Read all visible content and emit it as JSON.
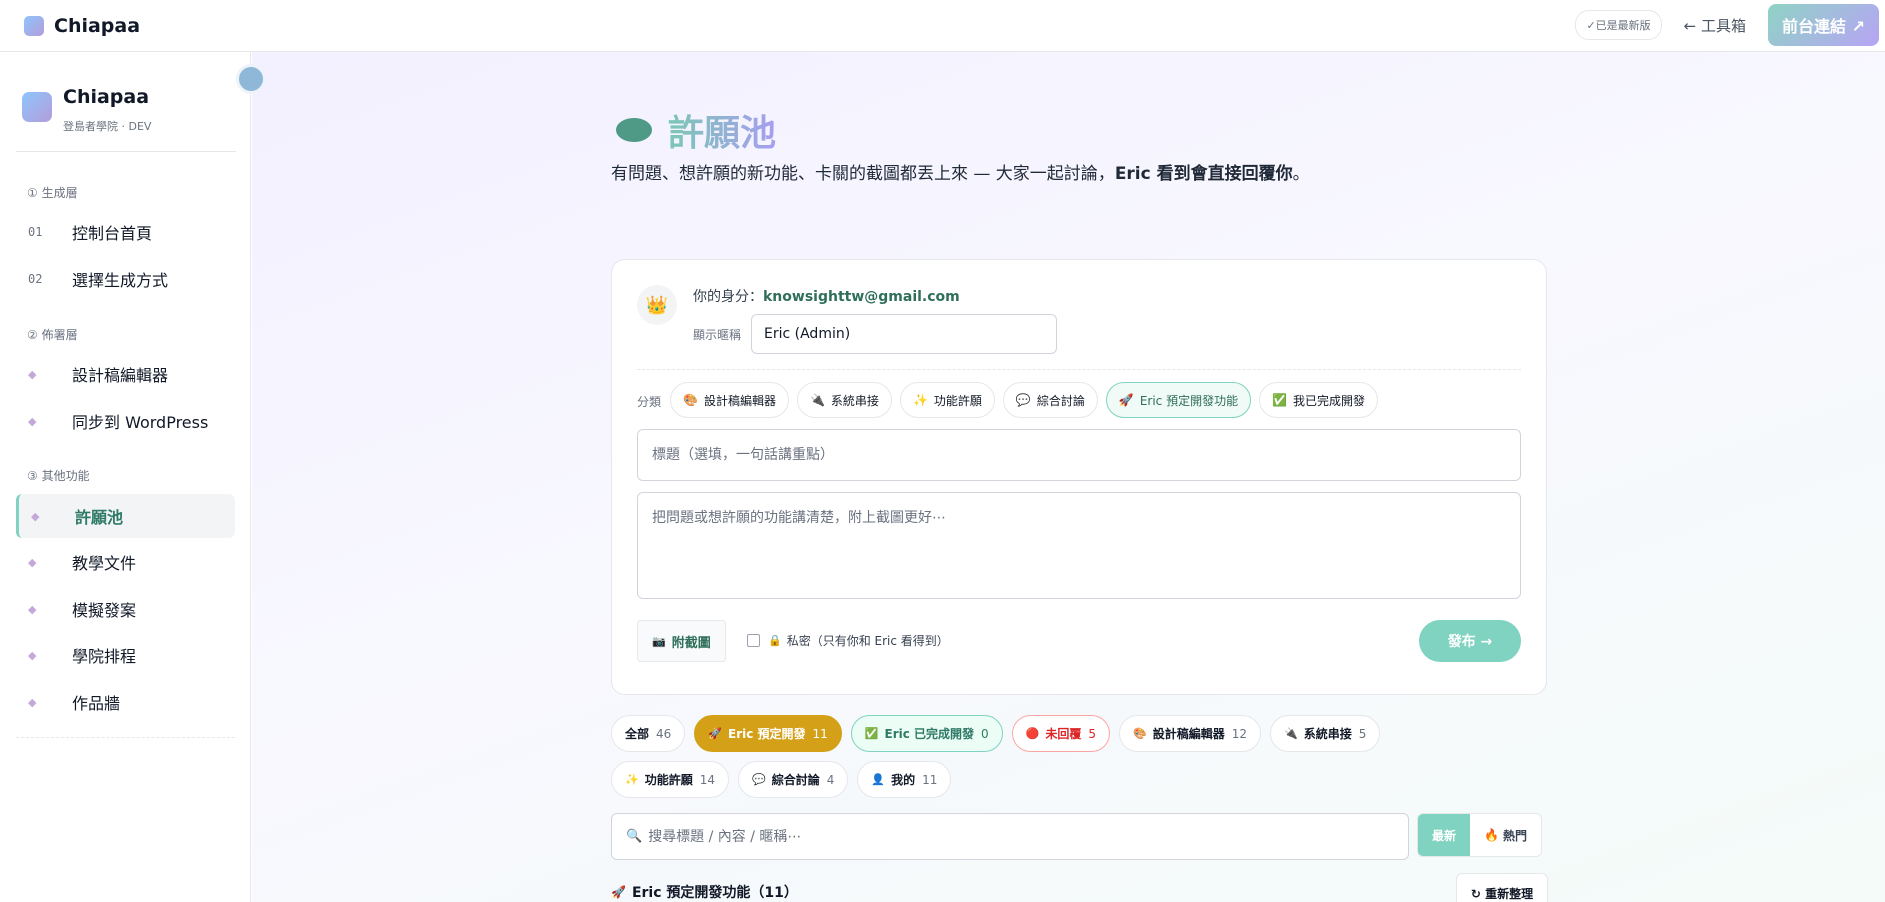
{
  "header": {
    "brand": "Chiapaa",
    "latest_badge": "✓已是最新版",
    "toolbox_link": "← 工具箱",
    "frontend_button": "前台連結 ↗"
  },
  "sidebar": {
    "title": "Chiapaa",
    "subtitle": "登島者學院 · DEV",
    "sections": [
      {
        "label": "① 生成層"
      },
      {
        "label": "② 佈署層"
      },
      {
        "label": "③ 其他功能"
      }
    ],
    "items": [
      {
        "marker": "01",
        "label": "控制台首頁"
      },
      {
        "marker": "02",
        "label": "選擇生成方式"
      },
      {
        "marker": "◆",
        "label": "設計稿編輯器"
      },
      {
        "marker": "◆",
        "label": "同步到 WordPress"
      },
      {
        "marker": "◆",
        "label": "許願池"
      },
      {
        "marker": "◆",
        "label": "教學文件"
      },
      {
        "marker": "◆",
        "label": "模擬發案"
      },
      {
        "marker": "◆",
        "label": "學院排程"
      },
      {
        "marker": "◆",
        "label": "作品牆"
      }
    ]
  },
  "page": {
    "title": "許願池",
    "desc_normal": "有問題、想許願的新功能、卡關的截圖都丟上來 — 大家一起討論，",
    "desc_bold": "Eric 看到會直接回覆你",
    "desc_end": "。"
  },
  "composer": {
    "avatar": "👑",
    "identity_label": "你的身分：",
    "identity_email": "knowsighttw@gmail.com",
    "nickname_label": "顯示暱稱",
    "nickname_value": "Eric (Admin)",
    "category_label": "分類",
    "categories": [
      {
        "icon": "🎨",
        "label": "設計稿編輯器"
      },
      {
        "icon": "🔌",
        "label": "系統串接"
      },
      {
        "icon": "✨",
        "label": "功能許願"
      },
      {
        "icon": "💬",
        "label": "綜合討論"
      },
      {
        "icon": "🚀",
        "label": "Eric 預定開發功能"
      },
      {
        "icon": "✅",
        "label": "我已完成開發"
      }
    ],
    "title_placeholder": "標題（選填，一句話講重點）",
    "body_placeholder": "把問題或想許願的功能講清楚，附上截圖更好⋯",
    "attach_icon": "📷",
    "attach_label": "附截圖",
    "private_icon": "🔒",
    "private_label": "私密（只有你和 Eric 看得到）",
    "publish_label": "發布 →"
  },
  "filters": [
    {
      "icon": "",
      "label": "全部",
      "count": "46"
    },
    {
      "icon": "🚀",
      "label": "Eric 預定開發",
      "count": "11"
    },
    {
      "icon": "✅",
      "label": "Eric 已完成開發",
      "count": "0"
    },
    {
      "icon": "🔴",
      "label": "未回覆",
      "count": "5"
    },
    {
      "icon": "🎨",
      "label": "設計稿編輯器",
      "count": "12"
    },
    {
      "icon": "🔌",
      "label": "系統串接",
      "count": "5"
    },
    {
      "icon": "✨",
      "label": "功能許願",
      "count": "14"
    },
    {
      "icon": "💬",
      "label": "綜合討論",
      "count": "4"
    },
    {
      "icon": "👤",
      "label": "我的",
      "count": "11"
    }
  ],
  "search": {
    "icon": "🔍",
    "placeholder": "搜尋標題 / 內容 / 暱稱⋯"
  },
  "sort": {
    "latest": "最新",
    "hot_icon": "🔥",
    "hot": "熱門"
  },
  "list": {
    "icon": "🚀",
    "heading": "Eric 預定開發功能（11）",
    "reorganize": "↻ 重新整理"
  }
}
